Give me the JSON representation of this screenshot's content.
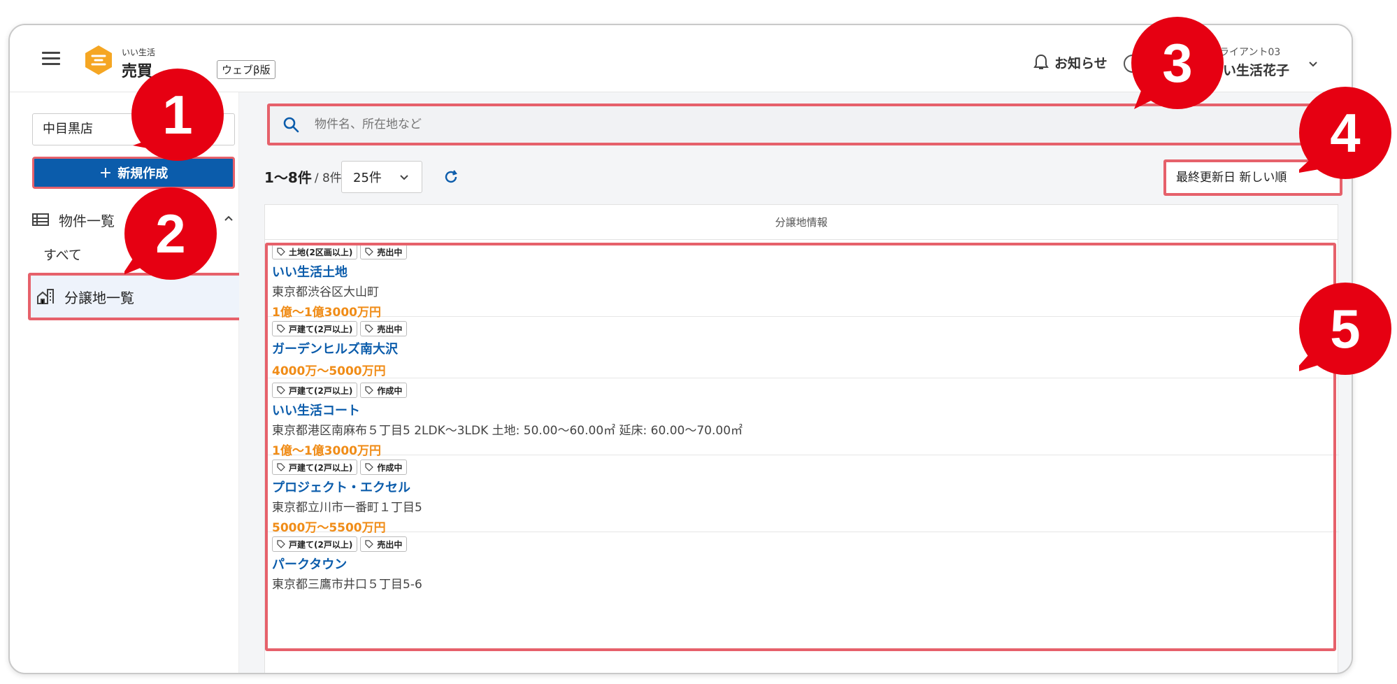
{
  "header": {
    "logo_small": "いい生活",
    "logo_main": "売買",
    "beta": "ウェブβ版",
    "notice": "お知らせ",
    "client": "クライアント03",
    "user": "いい生活花子"
  },
  "sidebar": {
    "store": "中目黒店",
    "new_button": "新規作成",
    "group_label": "物件一覧",
    "all_label": "すべて",
    "active_label": "分譲地一覧"
  },
  "main": {
    "search_placeholder": "物件名、所在地など",
    "count_range": "1〜8件",
    "count_total": "/ 8件",
    "per_page": "25件",
    "sort": "最終更新日 新しい順",
    "list_header": "分譲地情報",
    "rows": [
      {
        "tag1": "土地(2区画以上)",
        "tag2": "売出中",
        "title": "いい生活土地",
        "address": "東京都渋谷区大山町",
        "price": "1億〜1億3000万円"
      },
      {
        "tag1": "戸建て(2戸以上)",
        "tag2": "売出中",
        "title": "ガーデンヒルズ南大沢",
        "address": "",
        "price": "4000万〜5000万円"
      },
      {
        "tag1": "戸建て(2戸以上)",
        "tag2": "作成中",
        "title": "いい生活コート",
        "address": "東京都港区南麻布５丁目5  2LDK〜3LDK 土地: 50.00〜60.00㎡ 延床: 60.00〜70.00㎡",
        "price": "1億〜1億3000万円"
      },
      {
        "tag1": "戸建て(2戸以上)",
        "tag2": "作成中",
        "title": "プロジェクト・エクセル",
        "address": "東京都立川市一番町１丁目5",
        "price": "5000万〜5500万円"
      },
      {
        "tag1": "戸建て(2戸以上)",
        "tag2": "売出中",
        "title": "パークタウン",
        "address": "東京都三鷹市井口５丁目5-6",
        "price": ""
      }
    ]
  },
  "callouts": [
    "1",
    "2",
    "3",
    "4",
    "5"
  ],
  "colors": {
    "primary": "#0b5cab",
    "price": "#f08c17",
    "highlight": "#e6616b",
    "callout": "#e60012",
    "logo": "#f5a623"
  }
}
